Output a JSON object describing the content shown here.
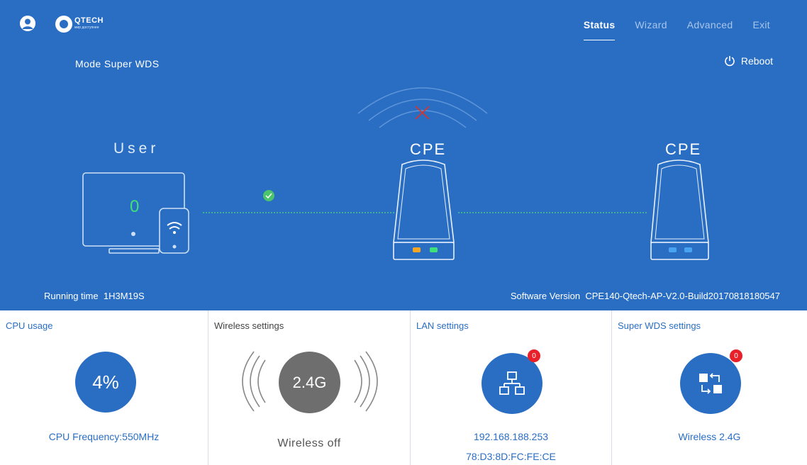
{
  "header": {
    "logo_name": "QTECH",
    "logo_tagline": "мир доступнее",
    "nav": [
      {
        "label": "Status",
        "active": true
      },
      {
        "label": "Wizard",
        "active": false
      },
      {
        "label": "Advanced",
        "active": false
      },
      {
        "label": "Exit",
        "active": false
      }
    ]
  },
  "topology": {
    "mode_label": "Mode",
    "mode_value": "Super WDS",
    "reboot_label": "Reboot",
    "user_label": "User",
    "user_count": "0",
    "cpe_local_label": "CPE",
    "cpe_remote_label": "CPE",
    "user_link_status": "connected",
    "wireless_link_status": "disconnected",
    "running_time_label": "Running time",
    "running_time_value": "1H3M19S",
    "software_version_label": "Software Version",
    "software_version_value": "CPE140-Qtech-AP-V2.0-Build20170818180547"
  },
  "cards": {
    "cpu": {
      "title": "CPU usage",
      "usage": "4%",
      "frequency": "CPU Frequency:550MHz"
    },
    "wireless": {
      "title": "Wireless settings",
      "band": "2.4G",
      "status": "Wireless off"
    },
    "lan": {
      "title": "LAN settings",
      "badge": "0",
      "ip": "192.168.188.253",
      "mac": "78:D3:8D:FC:FE:CE"
    },
    "wds": {
      "title": "Super WDS settings",
      "badge": "0",
      "band": "Wireless 2.4G"
    }
  },
  "colors": {
    "primary": "#2a6ec4",
    "accent_green": "#3fe07a",
    "alert_red": "#e8202a",
    "led_orange": "#f5a623",
    "led_blue": "#4aa3f0"
  },
  "icons": {
    "user": "user-icon",
    "reboot": "power-icon",
    "link_ok": "check-icon",
    "link_down": "x-icon",
    "wifi": "wifi-icon",
    "lan": "network-topology-icon",
    "wds": "wds-bridge-icon"
  }
}
